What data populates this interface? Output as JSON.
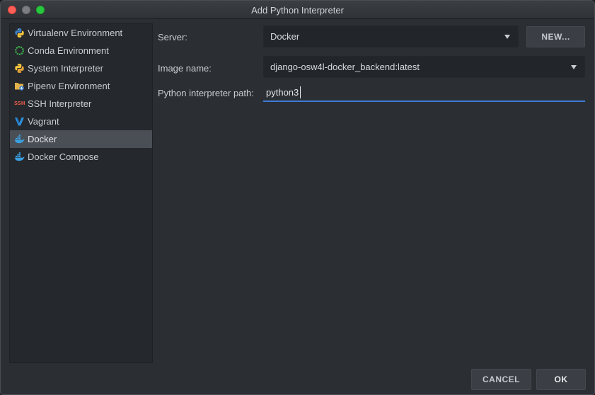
{
  "window": {
    "title": "Add Python Interpreter"
  },
  "sidebar": {
    "items": [
      {
        "label": "Virtualenv Environment",
        "icon": "python-icon"
      },
      {
        "label": "Conda Environment",
        "icon": "conda-icon"
      },
      {
        "label": "System Interpreter",
        "icon": "python-icon"
      },
      {
        "label": "Pipenv Environment",
        "icon": "pipenv-icon"
      },
      {
        "label": "SSH Interpreter",
        "icon": "ssh-icon"
      },
      {
        "label": "Vagrant",
        "icon": "vagrant-icon"
      },
      {
        "label": "Docker",
        "icon": "docker-icon",
        "selected": true
      },
      {
        "label": "Docker Compose",
        "icon": "docker-icon"
      }
    ],
    "ssh_icon_text": "SSH"
  },
  "form": {
    "server_label": "Server:",
    "server_value": "Docker",
    "new_button": "NEW...",
    "image_label": "Image name:",
    "image_value": "django-osw4l-docker_backend:latest",
    "path_label": "Python interpreter path:",
    "path_value": "python3"
  },
  "footer": {
    "cancel": "CANCEL",
    "ok": "OK"
  },
  "colors": {
    "accent_focus": "#3d7bd8",
    "selection": "#4a4f56",
    "docker_blue": "#3aa0e0"
  }
}
